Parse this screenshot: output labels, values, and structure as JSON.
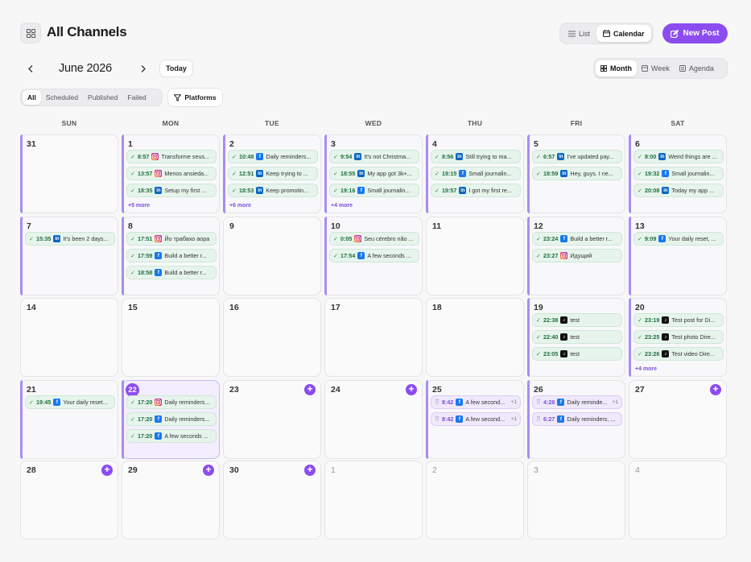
{
  "header": {
    "title": "All Channels",
    "view_list": "List",
    "view_calendar": "Calendar",
    "new_post": "New Post"
  },
  "nav": {
    "month_label": "June 2026",
    "today": "Today",
    "ranges": [
      "Month",
      "Week",
      "Agenda"
    ]
  },
  "filters": {
    "tabs": [
      "All",
      "Scheduled",
      "Published",
      "Failed"
    ],
    "platforms": "Platforms"
  },
  "weekdays": [
    "SUN",
    "MON",
    "TUE",
    "WED",
    "THU",
    "FRI",
    "SAT"
  ],
  "weeks": [
    [
      {
        "day": "31",
        "bar": true,
        "events": []
      },
      {
        "day": "1",
        "bar": true,
        "more": "+5 more",
        "events": [
          {
            "time": "8:57",
            "platform": "instagram",
            "text": "Transforme seus..."
          },
          {
            "time": "13:57",
            "platform": "instagram",
            "text": "Menos ansieda..."
          },
          {
            "time": "18:35",
            "platform": "linkedin",
            "text": "Setup my first ..."
          }
        ]
      },
      {
        "day": "2",
        "bar": true,
        "more": "+6 more",
        "events": [
          {
            "time": "10:48",
            "platform": "facebook",
            "text": "Daily reminders..."
          },
          {
            "time": "12:51",
            "platform": "linkedin",
            "text": "Keep trying to ..."
          },
          {
            "time": "18:53",
            "platform": "linkedin",
            "text": "Keep promotin..."
          }
        ]
      },
      {
        "day": "3",
        "bar": true,
        "more": "+4 more",
        "events": [
          {
            "time": "9:54",
            "platform": "linkedin",
            "text": "It's not Christma..."
          },
          {
            "time": "18:55",
            "platform": "linkedin",
            "text": "My app got 3k+..."
          },
          {
            "time": "19:16",
            "platform": "facebook",
            "text": "Small journalin..."
          }
        ]
      },
      {
        "day": "4",
        "bar": true,
        "events": [
          {
            "time": "8:56",
            "platform": "linkedin",
            "text": "Still trying to ma..."
          },
          {
            "time": "19:15",
            "platform": "facebook",
            "text": "Small journalin..."
          },
          {
            "time": "19:57",
            "platform": "linkedin",
            "text": "I got my first re..."
          }
        ]
      },
      {
        "day": "5",
        "bar": true,
        "events": [
          {
            "time": "6:57",
            "platform": "linkedin",
            "text": "I've updated pay..."
          },
          {
            "time": "18:59",
            "platform": "linkedin",
            "text": "Hey, guys. I ne..."
          }
        ]
      },
      {
        "day": "6",
        "bar": true,
        "events": [
          {
            "time": "8:00",
            "platform": "linkedin",
            "text": "Weird things are ..."
          },
          {
            "time": "19:32",
            "platform": "facebook",
            "text": "Small journalin..."
          },
          {
            "time": "20:08",
            "platform": "linkedin",
            "text": "Today my app ..."
          }
        ]
      }
    ],
    [
      {
        "day": "7",
        "bar": true,
        "events": [
          {
            "time": "15:35",
            "platform": "linkedin",
            "text": "It's been 2 days..."
          }
        ]
      },
      {
        "day": "8",
        "bar": true,
        "events": [
          {
            "time": "17:51",
            "platform": "instagram",
            "text": "Йо трабахо аора"
          },
          {
            "time": "17:59",
            "platform": "facebook",
            "text": "Build a better r..."
          },
          {
            "time": "18:58",
            "platform": "facebook",
            "text": "Build a better r..."
          }
        ]
      },
      {
        "day": "9",
        "bar": false,
        "events": []
      },
      {
        "day": "10",
        "bar": true,
        "events": [
          {
            "time": "0:05",
            "platform": "instagram",
            "text": "Seu cérebro não ..."
          },
          {
            "time": "17:54",
            "platform": "facebook",
            "text": "A few seconds ..."
          }
        ]
      },
      {
        "day": "11",
        "bar": false,
        "events": []
      },
      {
        "day": "12",
        "bar": true,
        "events": [
          {
            "time": "23:24",
            "platform": "facebook",
            "text": "Build a better r..."
          },
          {
            "time": "23:27",
            "platform": "instagram",
            "text": "Идущий"
          }
        ]
      },
      {
        "day": "13",
        "bar": true,
        "events": [
          {
            "time": "9:09",
            "platform": "facebook",
            "text": "Your daily reset, ..."
          }
        ]
      }
    ],
    [
      {
        "day": "14",
        "bar": false,
        "events": []
      },
      {
        "day": "15",
        "bar": false,
        "events": []
      },
      {
        "day": "16",
        "bar": false,
        "events": []
      },
      {
        "day": "17",
        "bar": false,
        "events": []
      },
      {
        "day": "18",
        "bar": false,
        "events": []
      },
      {
        "day": "19",
        "bar": true,
        "events": [
          {
            "time": "22:38",
            "platform": "tiktok",
            "text": "test"
          },
          {
            "time": "22:40",
            "platform": "tiktok",
            "text": "test"
          },
          {
            "time": "23:05",
            "platform": "tiktok",
            "text": "test"
          }
        ]
      },
      {
        "day": "20",
        "bar": true,
        "more": "+4 more",
        "events": [
          {
            "time": "23:19",
            "platform": "tiktok",
            "text": "Test post for Di..."
          },
          {
            "time": "23:25",
            "platform": "tiktok",
            "text": "Test photo Dire..."
          },
          {
            "time": "23:26",
            "platform": "tiktok",
            "text": "Test video Dire..."
          }
        ]
      }
    ],
    [
      {
        "day": "21",
        "bar": true,
        "events": [
          {
            "time": "19:45",
            "platform": "facebook",
            "text": "Your daily reset..."
          }
        ]
      },
      {
        "day": "22",
        "bar": true,
        "today": true,
        "events": [
          {
            "time": "17:20",
            "platform": "instagram",
            "text": "Daily reminders..."
          },
          {
            "time": "17:20",
            "platform": "facebook",
            "text": "Daily reminders..."
          },
          {
            "time": "17:20",
            "platform": "facebook",
            "text": "A few seconds ..."
          }
        ]
      },
      {
        "day": "23",
        "bar": false,
        "plus": true,
        "events": []
      },
      {
        "day": "24",
        "bar": false,
        "plus": true,
        "events": []
      },
      {
        "day": "25",
        "bar": true,
        "events": [
          {
            "time": "8:42",
            "platform": "facebook",
            "text": "A few second...",
            "extra": "+1",
            "pending": true
          },
          {
            "time": "8:42",
            "platform": "facebook",
            "text": "A few second...",
            "extra": "+1",
            "pending": true
          }
        ]
      },
      {
        "day": "26",
        "bar": true,
        "events": [
          {
            "time": "4:28",
            "platform": "facebook",
            "text": "Daily reminde...",
            "extra": "+1",
            "pending": true
          },
          {
            "time": "6:27",
            "platform": "facebook",
            "text": "Daily reminders, ...",
            "pending": true
          }
        ]
      },
      {
        "day": "27",
        "bar": false,
        "plus": true,
        "events": []
      }
    ],
    [
      {
        "day": "28",
        "plus": true,
        "events": []
      },
      {
        "day": "29",
        "plus": true,
        "events": []
      },
      {
        "day": "30",
        "plus": true,
        "events": []
      },
      {
        "day": "1",
        "dim": true,
        "events": []
      },
      {
        "day": "2",
        "dim": true,
        "events": []
      },
      {
        "day": "3",
        "dim": true,
        "events": []
      },
      {
        "day": "4",
        "dim": true,
        "events": []
      }
    ]
  ]
}
